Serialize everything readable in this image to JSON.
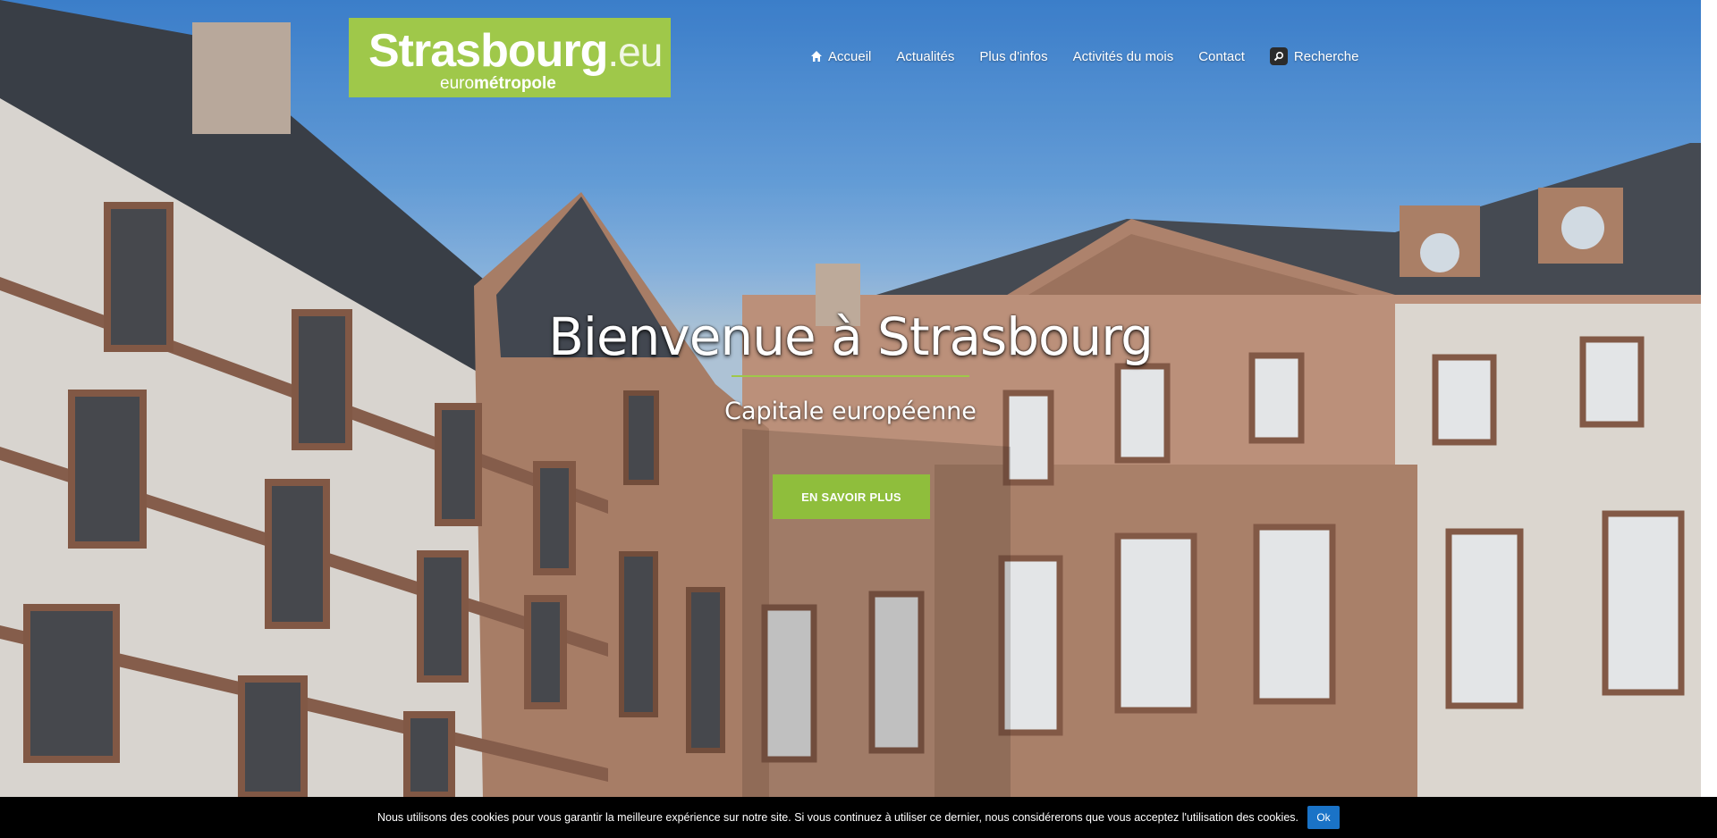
{
  "brand": {
    "name": "Strasbourg",
    "tld": ".eu",
    "sub_prefix": "euro",
    "sub_strong": "métropole",
    "green": "#9fc84a"
  },
  "nav": {
    "items": [
      {
        "label": "Accueil",
        "icon": "home-icon"
      },
      {
        "label": "Actualités"
      },
      {
        "label": "Plus d'infos"
      },
      {
        "label": "Activités du mois"
      },
      {
        "label": "Contact"
      },
      {
        "label": "Recherche",
        "icon": "search-icon"
      }
    ]
  },
  "hero": {
    "title": "Bienvenue à Strasbourg",
    "subtitle": "Capitale européenne",
    "cta_label": "EN SAVOIR PLUS"
  },
  "cookie_bar": {
    "message": "Nous utilisons des cookies pour vous garantir la meilleure expérience sur notre site. Si vous continuez à utiliser ce dernier, nous considérerons que vous acceptez l'utilisation des cookies.",
    "ok_label": "Ok",
    "button_color": "#1a73c7"
  }
}
